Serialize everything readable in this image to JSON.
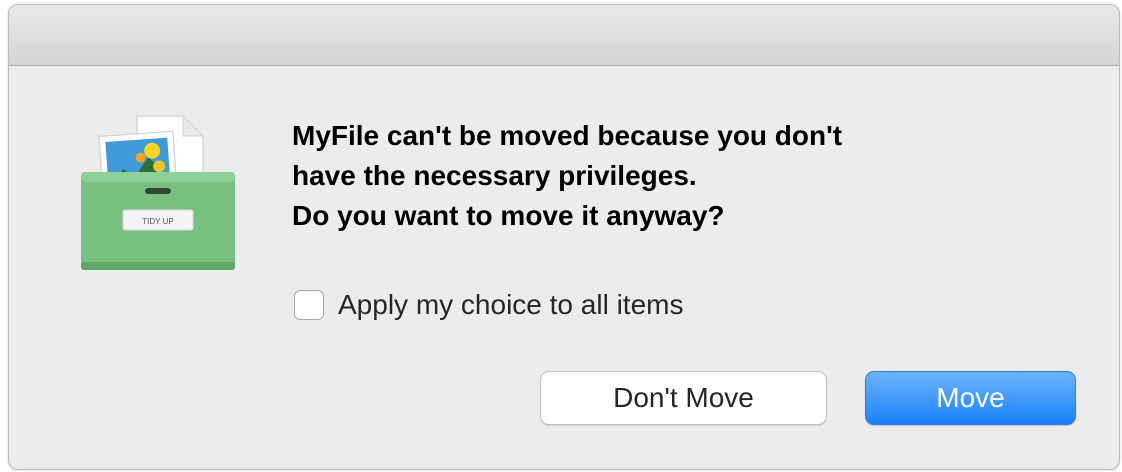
{
  "dialog": {
    "message_lines": [
      "MyFile can't be moved because you don't",
      "have the necessary privileges.",
      "Do you want to move it anyway?"
    ],
    "app_icon": "tidy-up-drawer-icon",
    "icon_label": "TIDY UP",
    "checkbox": {
      "label": "Apply my choice to all items",
      "checked": false
    },
    "buttons": {
      "cancel_label": "Don't Move",
      "confirm_label": "Move"
    },
    "colors": {
      "accent": "#1b82fb",
      "icon_green": "#77c07f"
    }
  }
}
